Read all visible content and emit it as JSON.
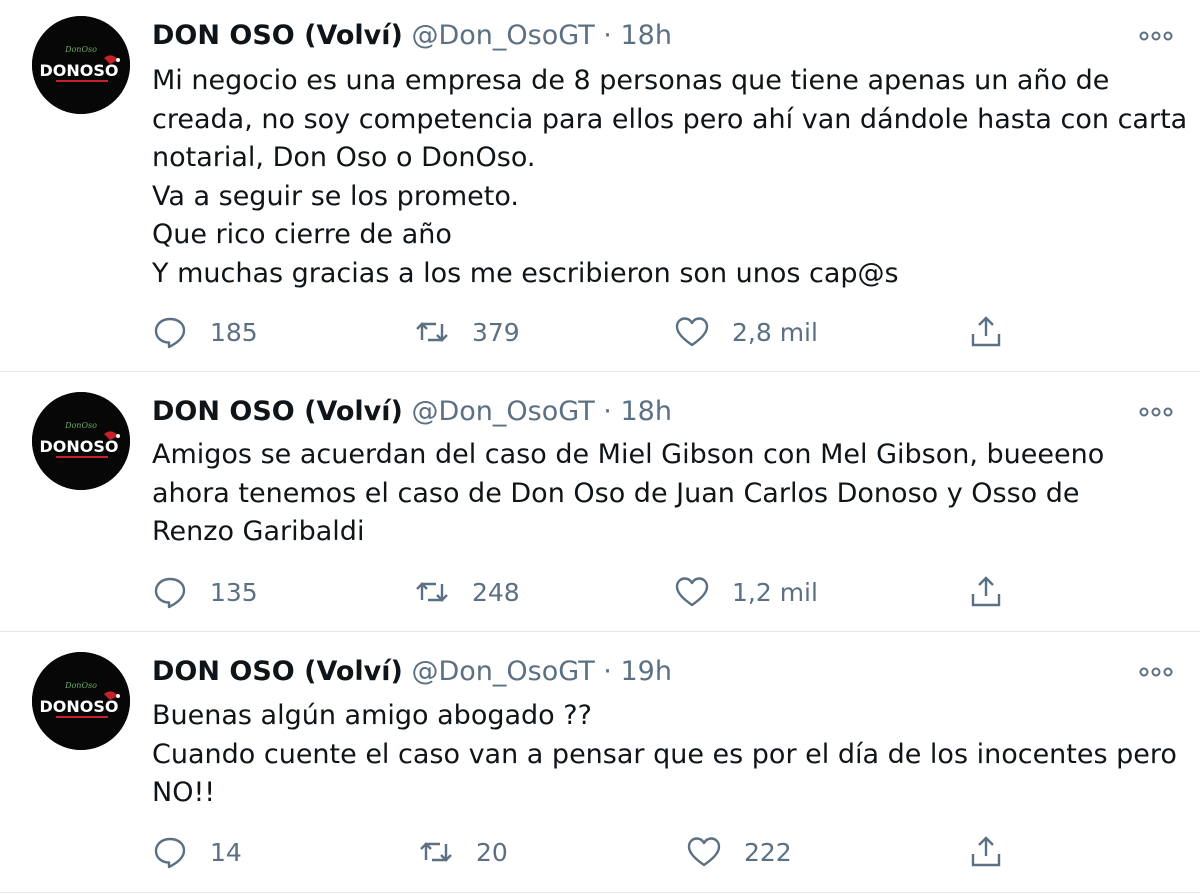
{
  "tweets": [
    {
      "author": {
        "name": "DON OSO (Volví)",
        "handle": "@Don_OsoGT",
        "avatar_text": "DONOSO"
      },
      "time": "18h",
      "separator": "·",
      "lines": [
        "Mi negocio es una empresa de 8 personas que tiene apenas un año de",
        "creada, no soy competencia para ellos pero ahí van dándole hasta con carta",
        "notarial, Don Oso o DonOso.",
        "Va a seguir se los prometo.",
        "Que rico cierre de año",
        "Y muchas gracias a los me escribieron son unos cap@s"
      ],
      "stats": {
        "replies": "185",
        "retweets": "379",
        "likes": "2,8 mil"
      }
    },
    {
      "author": {
        "name": "DON OSO (Volví)",
        "handle": "@Don_OsoGT",
        "avatar_text": "DONOSO"
      },
      "time": "18h",
      "separator": "·",
      "lines": [
        "Amigos se acuerdan del caso de Miel Gibson con Mel Gibson, bueeeno",
        "ahora tenemos el caso de Don Oso de  Juan Carlos Donoso  y Osso  de",
        "Renzo Garibaldi"
      ],
      "stats": {
        "replies": "135",
        "retweets": "248",
        "likes": "1,2 mil"
      }
    },
    {
      "author": {
        "name": "DON OSO (Volví)",
        "handle": "@Don_OsoGT",
        "avatar_text": "DONOSO"
      },
      "time": "19h",
      "separator": "·",
      "lines": [
        "Buenas algún amigo abogado ??",
        "Cuando cuente el caso van a pensar que es por el día de los inocentes pero",
        "NO!!"
      ],
      "stats": {
        "replies": "14",
        "retweets": "20",
        "likes": "222"
      }
    }
  ],
  "colors": {
    "text": "#0f1419",
    "muted": "#5b7083",
    "divider": "#e3e7ea",
    "avatar_bg": "#070707",
    "avatar_accent": "#c8202a"
  },
  "icons": {
    "reply": "reply-icon",
    "retweet": "retweet-icon",
    "like": "like-icon",
    "share": "share-icon",
    "more": "more-icon"
  }
}
